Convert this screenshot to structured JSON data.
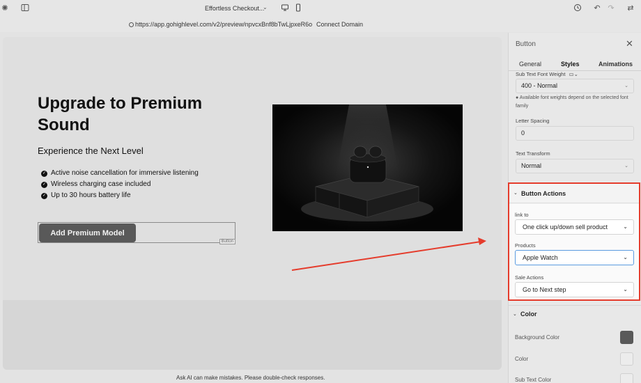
{
  "toolbar": {
    "doc_title": "Effortless Checkout..."
  },
  "urlbar": {
    "url": "https://app.gohighlevel.com/v2/preview/npvcxBnf8bTwLjpxeR6o",
    "connect_domain": "Connect Domain"
  },
  "hero": {
    "title": "Upgrade to Premium Sound",
    "subtitle": "Experience the Next Level",
    "features": [
      "Active noise cancellation for immersive listening",
      "Wireless charging case included",
      "Up to 30 hours battery life"
    ],
    "cta_label": "Add Premium Model",
    "cta_tag": "Button"
  },
  "ai_note": "Ask AI can make mistakes. Please double-check responses.",
  "panel": {
    "title": "Button",
    "tabs": [
      "General",
      "Styles",
      "Animations"
    ],
    "active_tab": "Styles",
    "sub_text_font_weight_label": "Sub Text Font Weight",
    "font_weight_value": "400 - Normal",
    "font_weight_note": "Available font weights depend on the selected font family",
    "letter_spacing_label": "Letter Spacing",
    "letter_spacing_value": "0",
    "text_transform_label": "Text Transform",
    "text_transform_value": "Normal",
    "button_actions": {
      "header": "Button Actions",
      "link_to_label": "link to",
      "link_to_value": "One click up/down sell product",
      "products_label": "Products",
      "products_value": "Apple Watch",
      "sale_actions_label": "Sale Actions",
      "sale_actions_value": "Go to Next step"
    },
    "color_section": {
      "header": "Color",
      "background_color_label": "Background Color",
      "color_label": "Color",
      "sub_text_color_label": "Sub Text Color"
    }
  },
  "colors": {
    "highlight": "#e53c2c",
    "cta_background": "#595959",
    "background_swatch": "#595959"
  }
}
